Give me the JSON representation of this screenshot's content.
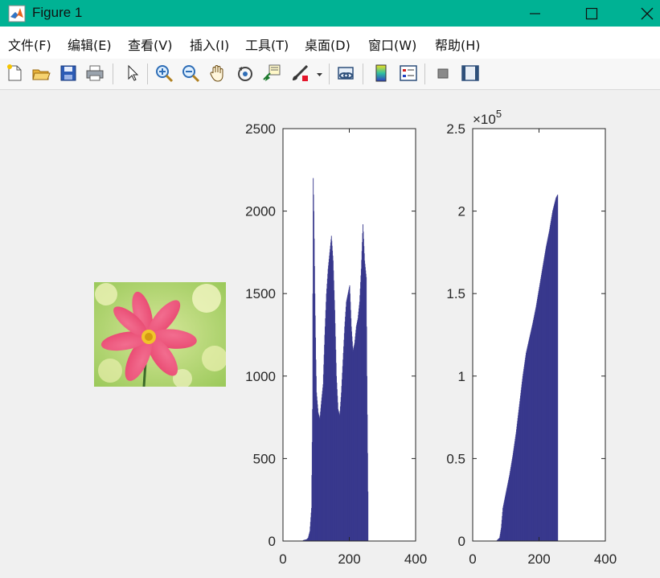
{
  "window": {
    "title": "Figure 1",
    "minimize_label": "Minimize",
    "maximize_label": "Maximize",
    "close_label": "Close"
  },
  "menu": [
    {
      "label": "文件(F)"
    },
    {
      "label": "编辑(E)"
    },
    {
      "label": "查看(V)"
    },
    {
      "label": "插入(I)"
    },
    {
      "label": "工具(T)"
    },
    {
      "label": "桌面(D)"
    },
    {
      "label": "窗口(W)"
    },
    {
      "label": "帮助(H)"
    }
  ],
  "toolbar": {
    "icons": [
      "new-figure-icon",
      "open-file-icon",
      "save-icon",
      "print-icon",
      "pointer-icon",
      "zoom-in-icon",
      "zoom-out-icon",
      "pan-icon",
      "rotate-3d-icon",
      "data-cursor-icon",
      "brush-icon",
      "brush-dropdown-icon",
      "link-plot-icon",
      "colorbar-icon",
      "legend-icon",
      "hide-plot-tools-icon",
      "show-plot-tools-icon"
    ]
  },
  "image": {
    "subject": "pink cosmos flower"
  },
  "chart_data": [
    {
      "type": "bar",
      "title": "",
      "xlabel": "",
      "ylabel": "",
      "xlim": [
        0,
        400
      ],
      "ylim": [
        0,
        2500
      ],
      "xticks": [
        "0",
        "200",
        "400"
      ],
      "yticks": [
        "0",
        "500",
        "1000",
        "1500",
        "2000",
        "2500"
      ],
      "exponent_label": "",
      "color": "#36368c",
      "x": [
        60,
        70,
        75,
        80,
        85,
        88,
        90,
        92,
        95,
        98,
        100,
        105,
        110,
        115,
        120,
        125,
        130,
        135,
        140,
        145,
        150,
        155,
        160,
        165,
        170,
        175,
        180,
        185,
        190,
        195,
        200,
        205,
        210,
        215,
        220,
        225,
        230,
        235,
        240,
        245,
        250,
        252,
        255
      ],
      "values": [
        5,
        10,
        20,
        60,
        200,
        800,
        2200,
        2000,
        1500,
        1100,
        900,
        780,
        740,
        850,
        950,
        1250,
        1500,
        1650,
        1750,
        1850,
        1700,
        1400,
        1000,
        800,
        760,
        900,
        1100,
        1300,
        1450,
        1500,
        1550,
        1300,
        1150,
        1200,
        1300,
        1350,
        1450,
        1650,
        1920,
        1700,
        1600,
        1000,
        300
      ]
    },
    {
      "type": "bar",
      "title": "",
      "xlabel": "",
      "ylabel": "",
      "xlim": [
        0,
        400
      ],
      "ylim": [
        0,
        250000
      ],
      "xticks": [
        "0",
        "200",
        "400"
      ],
      "yticks": [
        "0",
        "0.5",
        "1",
        "1.5",
        "2",
        "2.5"
      ],
      "exponent_label": "×10^5",
      "color": "#36368c",
      "x": [
        70,
        80,
        85,
        90,
        95,
        100,
        110,
        120,
        130,
        140,
        150,
        160,
        170,
        180,
        190,
        200,
        210,
        220,
        230,
        240,
        250,
        255
      ],
      "values": [
        0,
        2000,
        8000,
        20000,
        25000,
        30000,
        40000,
        52000,
        66000,
        83000,
        100000,
        114000,
        123000,
        132000,
        142000,
        154000,
        166000,
        178000,
        188000,
        200000,
        208000,
        210000
      ]
    }
  ]
}
